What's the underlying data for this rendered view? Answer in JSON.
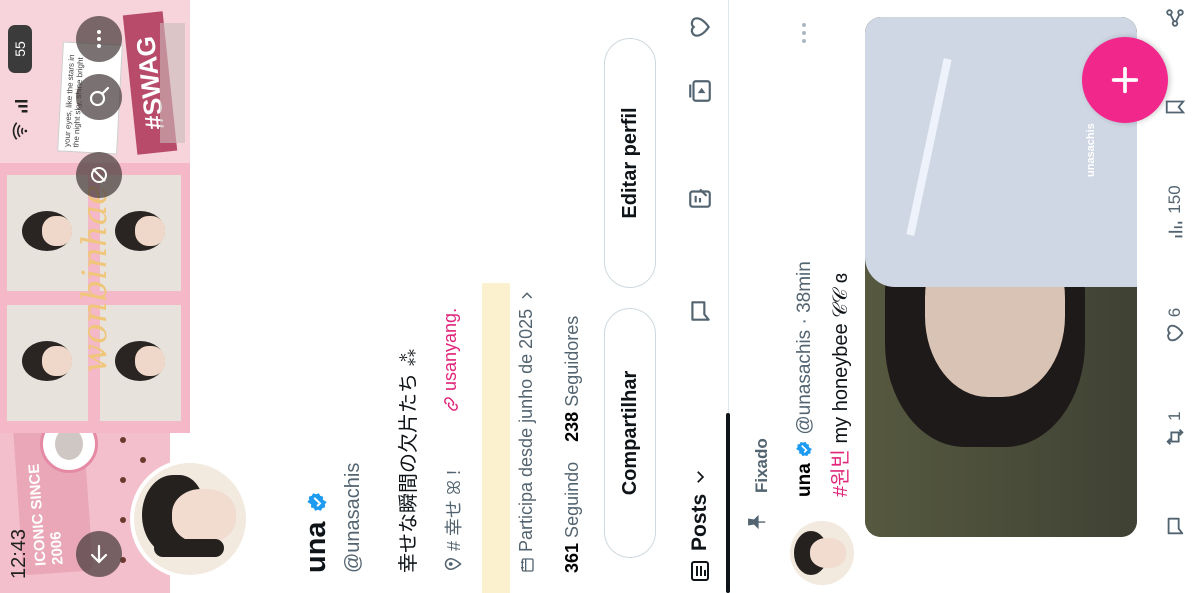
{
  "status_bar": {
    "time": "12:43",
    "battery": "55"
  },
  "banner": {
    "sticker_swag": "#SWAG",
    "sticker_iconic": "ICONIC SINCE 2006",
    "script_text": "wonbinhae",
    "note_text": "your eyes, like the stars in the night sky, shine bright"
  },
  "profile": {
    "name": "una",
    "handle": "@unasachis",
    "bio": "幸せな瞬間の欠片たち ⁂",
    "location": "# 幸せ ꕤ !",
    "link": "usanyang.",
    "joined": "Participa desde junho de 2025",
    "following_count": "361",
    "following_label": "Seguindo",
    "followers_count": "238",
    "followers_label": "Seguidores",
    "edit_button": "Editar perfil",
    "share_button": "Compartilhar"
  },
  "tabs": {
    "posts_label": "Posts"
  },
  "post": {
    "pinned_label": "Fixado",
    "author": "una",
    "handle_time": "@unasachis · 38min",
    "hashtag": "#원빈",
    "text": "my honeybee 𝒞𝒞 ɞ",
    "watermark": "unasachis",
    "stats": {
      "retweets": "1",
      "likes": "6",
      "views": "150"
    }
  },
  "colors": {
    "accent": "#e0257a",
    "fab": "#f2278c",
    "verified": "#1d9bf0",
    "banner_pink": "#f6c9d3"
  },
  "icons": [
    "back-icon",
    "search-icon",
    "more-icon",
    "eye-off-icon",
    "location-icon",
    "link-icon",
    "calendar-icon",
    "chevron-right-icon",
    "chevron-down-icon",
    "posts-icon",
    "edit-note-icon",
    "message-icon",
    "add-media-icon",
    "heart-icon",
    "pin-icon",
    "reply-icon",
    "retweet-icon",
    "like-icon",
    "views-icon",
    "bookmark-icon",
    "share-icon",
    "plus-icon"
  ]
}
